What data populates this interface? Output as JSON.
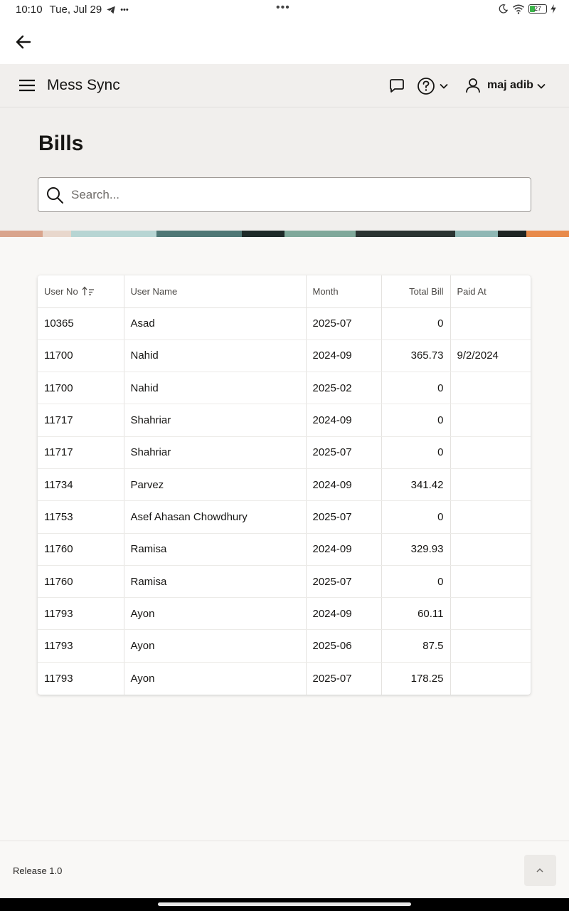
{
  "status_bar": {
    "time": "10:10",
    "date": "Tue, Jul 29",
    "more": "•••",
    "battery": "27"
  },
  "header": {
    "app_title": "Mess Sync",
    "username": "maj adib"
  },
  "page": {
    "title": "Bills"
  },
  "search": {
    "placeholder": "Search..."
  },
  "table": {
    "columns": [
      "User No",
      "User Name",
      "Month",
      "Total Bill",
      "Paid At"
    ],
    "rows": [
      [
        "10365",
        "Asad",
        "2025-07",
        "0",
        ""
      ],
      [
        "11700",
        "Nahid",
        "2024-09",
        "365.73",
        "9/2/2024"
      ],
      [
        "11700",
        "Nahid",
        "2025-02",
        "0",
        ""
      ],
      [
        "11717",
        "Shahriar",
        "2024-09",
        "0",
        ""
      ],
      [
        "11717",
        "Shahriar",
        "2025-07",
        "0",
        ""
      ],
      [
        "11734",
        "Parvez",
        "2024-09",
        "341.42",
        ""
      ],
      [
        "11753",
        "Asef Ahasan Chowdhury",
        "2025-07",
        "0",
        ""
      ],
      [
        "11760",
        "Ramisa",
        "2024-09",
        "329.93",
        ""
      ],
      [
        "11760",
        "Ramisa",
        "2025-07",
        "0",
        ""
      ],
      [
        "11793",
        "Ayon",
        "2024-09",
        "60.11",
        ""
      ],
      [
        "11793",
        "Ayon",
        "2025-06",
        "87.5",
        ""
      ],
      [
        "11793",
        "Ayon",
        "2025-07",
        "178.25",
        ""
      ]
    ]
  },
  "footer": {
    "release": "Release 1.0"
  },
  "colors": {
    "header_bg": "#f1efed",
    "page_bg": "#f9f8f6",
    "text": "#161513"
  },
  "icons": [
    "back-arrow-icon",
    "hamburger-menu-icon",
    "chat-bubble-icon",
    "help-circle-icon",
    "chevron-down-icon",
    "user-icon",
    "search-icon",
    "sort-ascending-icon",
    "chevron-up-icon"
  ]
}
